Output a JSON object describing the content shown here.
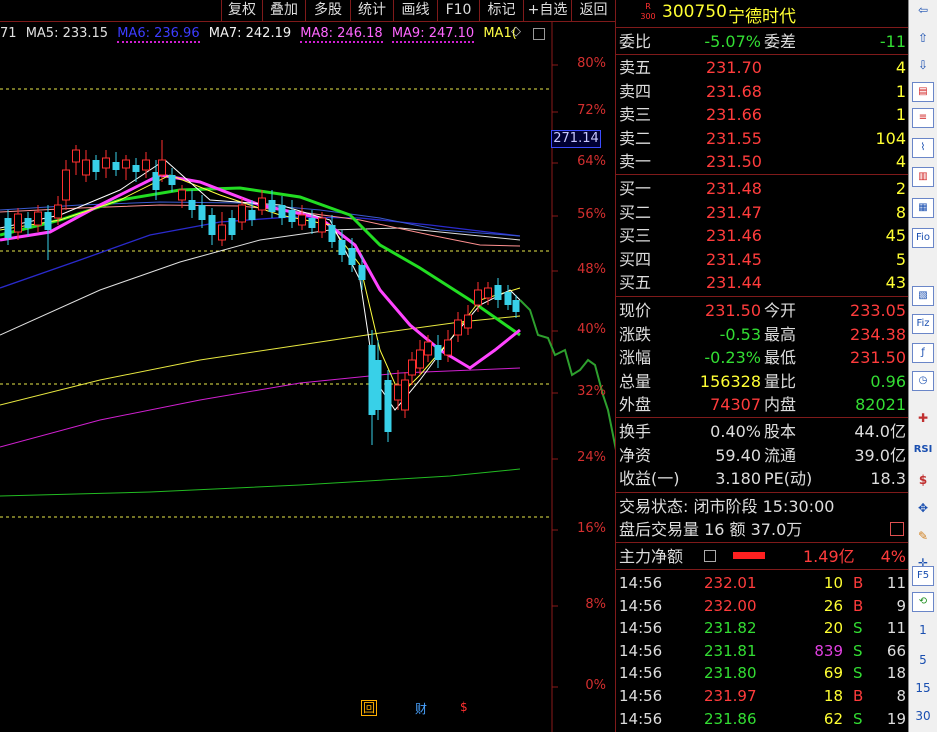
{
  "toolbar_top": [
    "复权",
    "叠加",
    "多股",
    "统计",
    "画线",
    "F10",
    "标记",
    "+自选",
    "返回"
  ],
  "ma_legend": {
    "ma4_tail": "71",
    "ma5": "MA5: 233.15",
    "ma6": "MA6: 236.96",
    "ma7": "MA7: 242.19",
    "ma8": "MA8: 246.18",
    "ma9": "MA9: 247.10",
    "ma10": "MA1(",
    "more_icon": "◇"
  },
  "pct_axis": [
    "80%",
    "72%",
    "64%",
    "56%",
    "48%",
    "40%",
    "32%",
    "24%",
    "16%",
    "8%",
    "0%"
  ],
  "price_marker": "271.14",
  "bottom_marks": {
    "a": "回",
    "b": "财",
    "c": "$"
  },
  "stock": {
    "badge_top": "R",
    "badge_bottom": "300",
    "code": "300750",
    "name": "宁德时代"
  },
  "ratio": {
    "l1": "委比",
    "v1": "-5.07%",
    "l2": "委差",
    "v2": "-11"
  },
  "asks": [
    {
      "label": "卖五",
      "price": "231.70",
      "vol": "4"
    },
    {
      "label": "卖四",
      "price": "231.68",
      "vol": "1"
    },
    {
      "label": "卖三",
      "price": "231.66",
      "vol": "1"
    },
    {
      "label": "卖二",
      "price": "231.55",
      "vol": "104"
    },
    {
      "label": "卖一",
      "price": "231.50",
      "vol": "4"
    }
  ],
  "bids": [
    {
      "label": "买一",
      "price": "231.48",
      "vol": "2"
    },
    {
      "label": "买二",
      "price": "231.47",
      "vol": "8"
    },
    {
      "label": "买三",
      "price": "231.46",
      "vol": "45"
    },
    {
      "label": "买四",
      "price": "231.45",
      "vol": "5"
    },
    {
      "label": "买五",
      "price": "231.44",
      "vol": "43"
    }
  ],
  "quote": [
    {
      "l1": "现价",
      "v1": "231.50",
      "l2": "今开",
      "v2": "233.05"
    },
    {
      "l1": "涨跌",
      "v1": "-0.53",
      "l2": "最高",
      "v2": "234.38"
    },
    {
      "l1": "涨幅",
      "v1": "-0.23%",
      "l2": "最低",
      "v2": "231.50"
    },
    {
      "l1": "总量",
      "v1": "156328",
      "l2": "量比",
      "v2": "0.96"
    },
    {
      "l1": "外盘",
      "v1": "74307",
      "l2": "内盘",
      "v2": "82021"
    }
  ],
  "stats": [
    {
      "l1": "换手",
      "v1": "0.40%",
      "l2": "股本",
      "v2": "44.0亿"
    },
    {
      "l1": "净资",
      "v1": "59.40",
      "l2": "流通",
      "v2": "39.0亿"
    },
    {
      "l1": "收益(一)",
      "v1": "3.180",
      "l2": "PE(动)",
      "v2": "18.3"
    }
  ],
  "trade_status": "交易状态: 闭市阶段 15:30:00",
  "after_hours": "盘后交易量 16 额 37.0万",
  "main_flow": {
    "label": "主力净额",
    "value": "1.49亿",
    "pct": "4%"
  },
  "ticks": [
    {
      "time": "14:56",
      "price": "232.01",
      "vol": "10",
      "side": "B",
      "n": "11"
    },
    {
      "time": "14:56",
      "price": "232.00",
      "vol": "26",
      "side": "B",
      "n": "9"
    },
    {
      "time": "14:56",
      "price": "231.82",
      "vol": "20",
      "side": "S",
      "n": "11"
    },
    {
      "time": "14:56",
      "price": "231.81",
      "vol": "839",
      "side": "S",
      "n": "66"
    },
    {
      "time": "14:56",
      "price": "231.80",
      "vol": "69",
      "side": "S",
      "n": "18"
    },
    {
      "time": "14:56",
      "price": "231.97",
      "vol": "18",
      "side": "B",
      "n": "8"
    },
    {
      "time": "14:56",
      "price": "231.86",
      "vol": "62",
      "side": "S",
      "n": "19"
    }
  ],
  "side_toolbar_nums": [
    "1",
    "5",
    "15",
    "30"
  ],
  "side_toolbar_labels": [
    "Fio",
    "Fiz",
    "RSI",
    "F5"
  ]
}
